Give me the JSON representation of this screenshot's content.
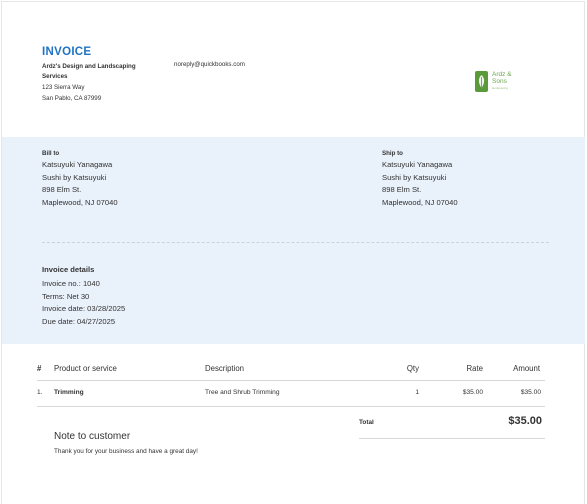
{
  "header": {
    "title": "INVOICE",
    "company_name": "Ardz's Design and Landscaping Services",
    "address_line1": "123 Sierra Way",
    "address_line2": "San Pablo, CA 87999",
    "email": "noreply@quickbooks.com",
    "logo_text_line1": "Ardz &",
    "logo_text_line2": "Sons",
    "logo_subtext": "landscaping",
    "logo_icon": "leaf-icon",
    "accent_color": "#1f72c4",
    "logo_color": "#5a9a3a"
  },
  "bill_to": {
    "label": "Bill to",
    "lines": [
      "Katsuyuki Yanagawa",
      "Sushi by Katsuyuki",
      "898 Elm St.",
      "Maplewood, NJ 07040"
    ]
  },
  "ship_to": {
    "label": "Ship to",
    "lines": [
      "Katsuyuki Yanagawa",
      "Sushi by Katsuyuki",
      "898 Elm St.",
      "Maplewood, NJ 07040"
    ]
  },
  "invoice_details": {
    "title": "Invoice details",
    "lines": [
      "Invoice no.: 1040",
      "Terms: Net 30",
      "Invoice date: 03/28/2025",
      "Due date: 04/27/2025"
    ]
  },
  "table": {
    "headers": {
      "index": "#",
      "product": "Product or service",
      "description": "Description",
      "qty": "Qty",
      "rate": "Rate",
      "amount": "Amount"
    },
    "rows": [
      {
        "index": "1.",
        "product": "Trimming",
        "description": "Tree and Shrub Trimming",
        "qty": "1",
        "rate": "$35.00",
        "amount": "$35.00"
      }
    ]
  },
  "totals": {
    "label": "Total",
    "value": "$35.00"
  },
  "note": {
    "title": "Note to customer",
    "text": "Thank you for your business and have a great day!"
  }
}
